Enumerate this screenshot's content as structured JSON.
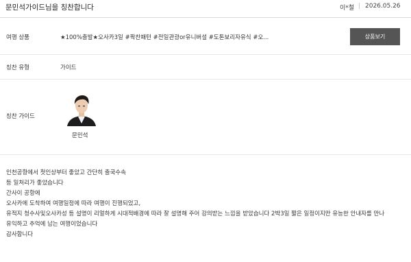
{
  "header": {
    "title": "문민석가이드님을 칭찬합니다",
    "author": "이*철",
    "date": "2026.05.26"
  },
  "product_row": {
    "label": "여행 상품",
    "value": "★100%출발★오사카3일 #팍찬패턴 #전일관광or유니버설 #도톤보리자유식 #오...",
    "button_label": "상품보기"
  },
  "type_row": {
    "label": "칭찬 유형",
    "value": "가이드"
  },
  "guide_row": {
    "label": "칭찬 가이드",
    "name": "문민석"
  },
  "review": {
    "lines": [
      "인천공항에서 첫인상부터 좋았고 간단히 출국수속",
      "등 일처리가 좋았습니다",
      "간사이 공항에",
      "오사카에 도착하여 여행일정에 따라 여행이 진행되었고,",
      "유적지 청수사및오사카성 등 설명이 리얼하게 시대적배경에 따라 잘 설명해 주어 강의받는 느낌을 받았습니다 2박3일 짧은 일정이지만 유능한 안내자를 만나",
      "유익하고 추억에 남는 여행이었습니다",
      "감사합니다"
    ]
  }
}
